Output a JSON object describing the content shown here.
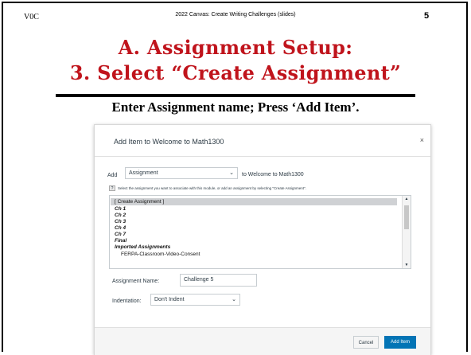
{
  "slide": {
    "version_label": "V0C",
    "header_title": "2022 Canvas: Create Writing Challenges (slides)",
    "page_number": "5",
    "title_line1": "A. Assignment Setup:",
    "title_line2": "3. Select “Create Assignment”",
    "subtitle": "Enter Assignment name; Press ‘Add Item’.",
    "title_color": "#c0141c"
  },
  "dialog": {
    "title": "Add Item to Welcome to Math1300",
    "close_glyph": "×",
    "add_label": "Add",
    "type_value": "Assignment",
    "to_text": "to Welcome to Math1300",
    "help_text": "Select the assignment you want to associate with this module, or add an assignment by selecting \"Create Assignment\".",
    "list_items": [
      "[ Create Assignment ]",
      "Ch 1",
      "Ch 2",
      "Ch 3",
      "Ch 4",
      "Ch 7",
      "Final",
      "Imported Assignments",
      "FERPA-Classroom-Video-Consent"
    ],
    "name_label": "Assignment Name:",
    "name_value": "Challenge 5",
    "indent_label": "Indentation:",
    "indent_value": "Don't Indent",
    "cancel_label": "Cancel",
    "add_item_label": "Add Item",
    "primary_color": "#0374b5"
  }
}
